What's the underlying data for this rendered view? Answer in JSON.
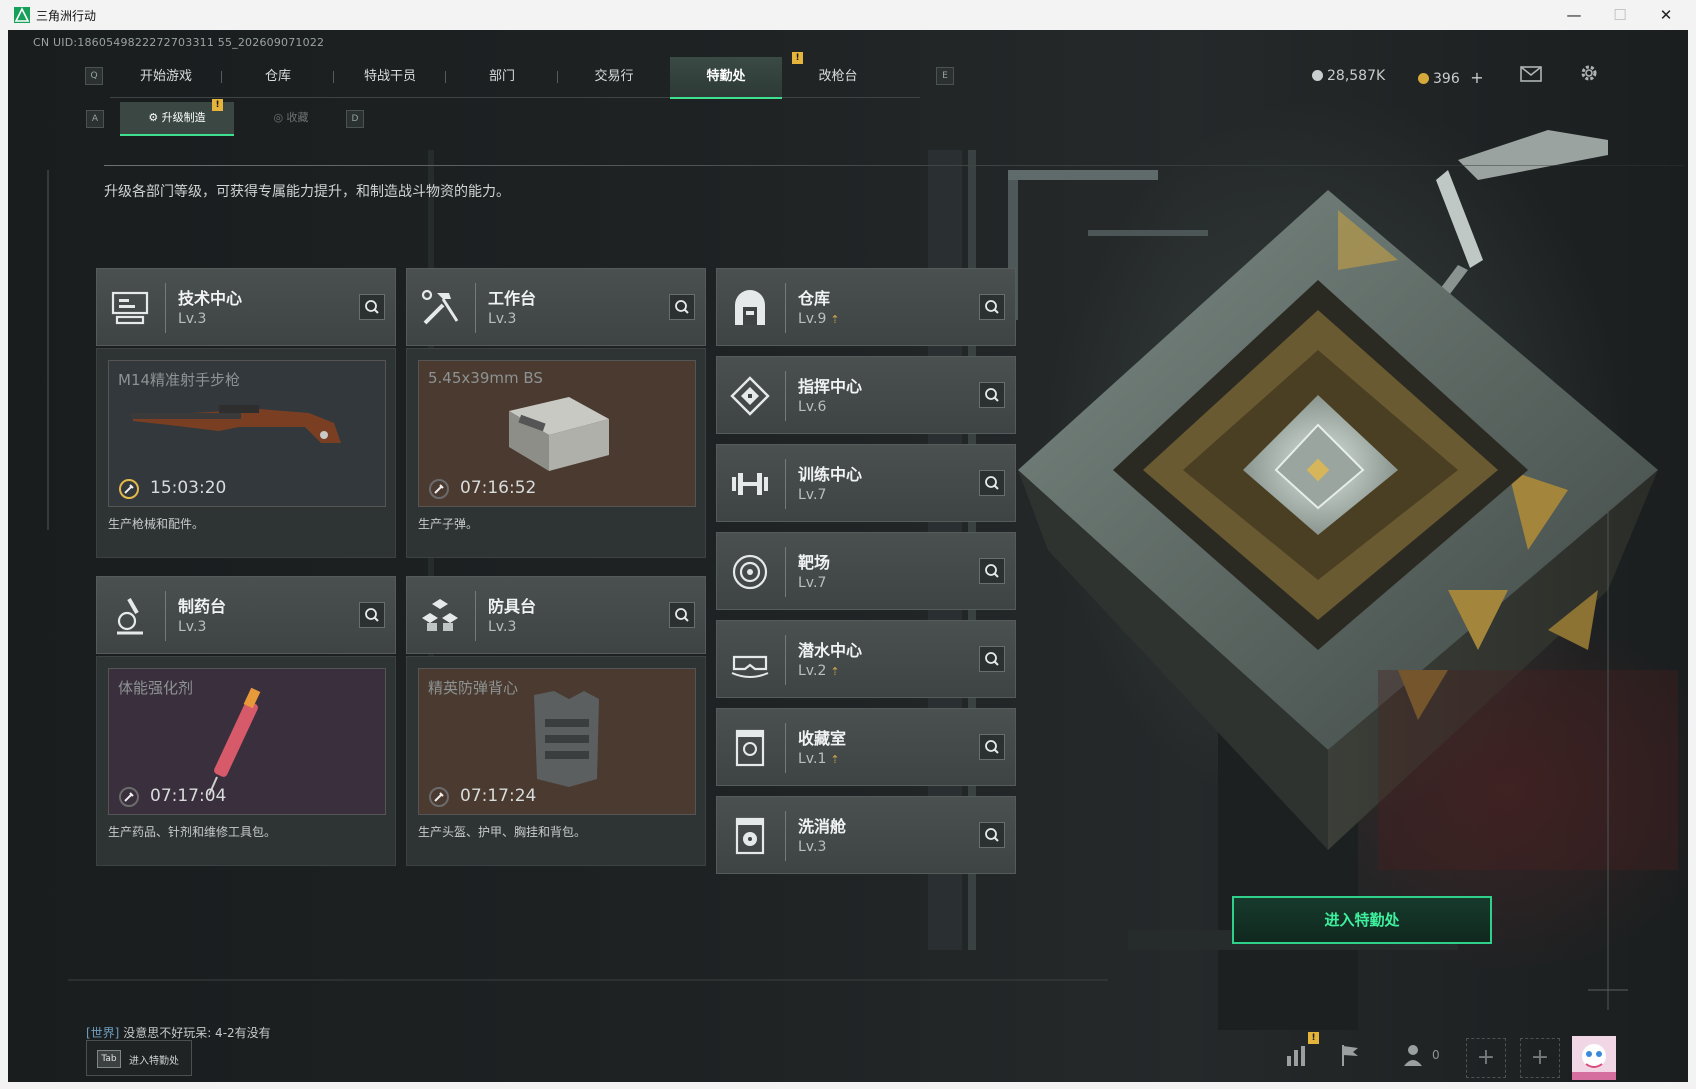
{
  "window": {
    "title": "三角洲行动",
    "min_label": "—",
    "max_label": "☐",
    "close_label": "✕"
  },
  "uid": "CN UID:1860549822272703311 55_202609071022",
  "keyhints": {
    "nav_left": "Q",
    "nav_right": "E",
    "sub_left": "A",
    "sub_right": "D"
  },
  "nav": {
    "items": [
      {
        "label": "开始游戏"
      },
      {
        "label": "仓库"
      },
      {
        "label": "特战干员"
      },
      {
        "label": "部门"
      },
      {
        "label": "交易行"
      },
      {
        "label": "特勤处",
        "active": true
      },
      {
        "label": "改枪台"
      }
    ],
    "badge": "!"
  },
  "currency": {
    "silver": "28,587K",
    "gold": "396",
    "gold_add": "+"
  },
  "subtabs": {
    "active": "升级制造",
    "inactive": "收藏",
    "badge": "!"
  },
  "description": "升级各部门等级，可获得专属能力提升，和制造战斗物资的能力。",
  "production_facilities": [
    {
      "name": "技术中心",
      "level": "Lv.3",
      "item": "M14精准射手步枪",
      "timer": "15:03:20",
      "desc": "生产枪械和配件。",
      "bg": "#32383b"
    },
    {
      "name": "工作台",
      "level": "Lv.3",
      "item": "5.45x39mm BS",
      "timer": "07:16:52",
      "desc": "生产子弹。",
      "bg": "#4a3a30"
    },
    {
      "name": "制药台",
      "level": "Lv.3",
      "item": "体能强化剂",
      "timer": "07:17:04",
      "desc": "生产药品、针剂和维修工具包。",
      "bg": "#3a2f3d"
    },
    {
      "name": "防具台",
      "level": "Lv.3",
      "item": "精英防弹背心",
      "timer": "07:17:24",
      "desc": "生产头盔、护甲、胸挂和背包。",
      "bg": "#4a3a30"
    }
  ],
  "facilities": [
    {
      "name": "仓库",
      "level": "Lv.9",
      "upgrade": true
    },
    {
      "name": "指挥中心",
      "level": "Lv.6",
      "upgrade": false
    },
    {
      "name": "训练中心",
      "level": "Lv.7",
      "upgrade": false
    },
    {
      "name": "靶场",
      "level": "Lv.7",
      "upgrade": false
    },
    {
      "name": "潜水中心",
      "level": "Lv.2",
      "upgrade": true
    },
    {
      "name": "收藏室",
      "level": "Lv.1",
      "upgrade": true
    },
    {
      "name": "洗消舱",
      "level": "Lv.3",
      "upgrade": false
    }
  ],
  "upgrade_marker": "⇡",
  "enter_button": "进入特勤处",
  "chat": {
    "channel": "[世界]",
    "message": "没意思不好玩呆: 4-2有没有"
  },
  "tab_hint": {
    "key": "Tab",
    "label": "进入特勤处"
  },
  "bottom_bar": {
    "stats_badge": "!",
    "friends_count": "0",
    "slot_plus": "+"
  },
  "colors": {
    "accent_green": "#3ee08f",
    "badge_yellow": "#e5b43a",
    "upgrade_gold": "#cfa645"
  }
}
